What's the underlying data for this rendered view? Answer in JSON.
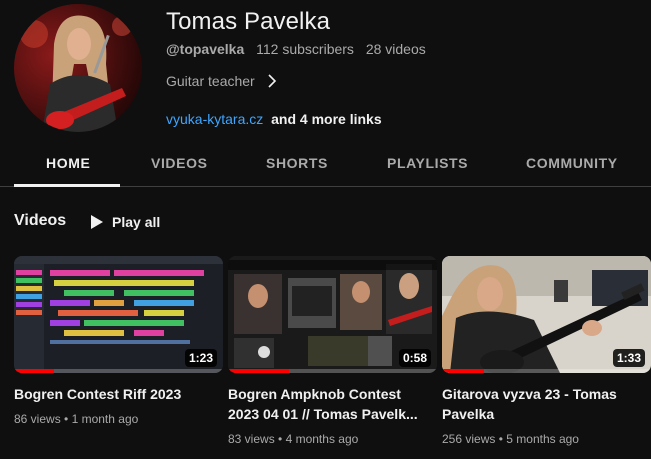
{
  "channel": {
    "name": "Tomas Pavelka",
    "handle": "@topavelka",
    "subscribers": "112 subscribers",
    "videos_count": "28 videos",
    "description": "Guitar teacher",
    "link": "vyuka-kytara.cz",
    "more_links": "and 4 more links"
  },
  "tabs": [
    {
      "label": "HOME",
      "active": true
    },
    {
      "label": "VIDEOS",
      "active": false
    },
    {
      "label": "SHORTS",
      "active": false
    },
    {
      "label": "PLAYLISTS",
      "active": false
    },
    {
      "label": "COMMUNITY",
      "active": false
    }
  ],
  "section": {
    "title": "Videos",
    "play_all": "Play all"
  },
  "videos": [
    {
      "title": "Bogren Contest Riff 2023",
      "duration": "1:23",
      "views": "86 views",
      "age": "1 month ago",
      "watched_fraction": 0.19
    },
    {
      "title": "Bogren Ampknob Contest 2023 04 01 // Tomas Pavelk...",
      "duration": "0:58",
      "views": "83 views",
      "age": "4 months ago",
      "watched_fraction": 0.29
    },
    {
      "title": "Gitarova vyzva 23 - Tomas Pavelka",
      "duration": "1:33",
      "views": "256 views",
      "age": "5 months ago",
      "watched_fraction": 0.2
    }
  ],
  "colors": {
    "background": "#0f0f0f",
    "link": "#3ea6ff",
    "progress": "#ff0000",
    "secondary_text": "#aaaaaa"
  }
}
